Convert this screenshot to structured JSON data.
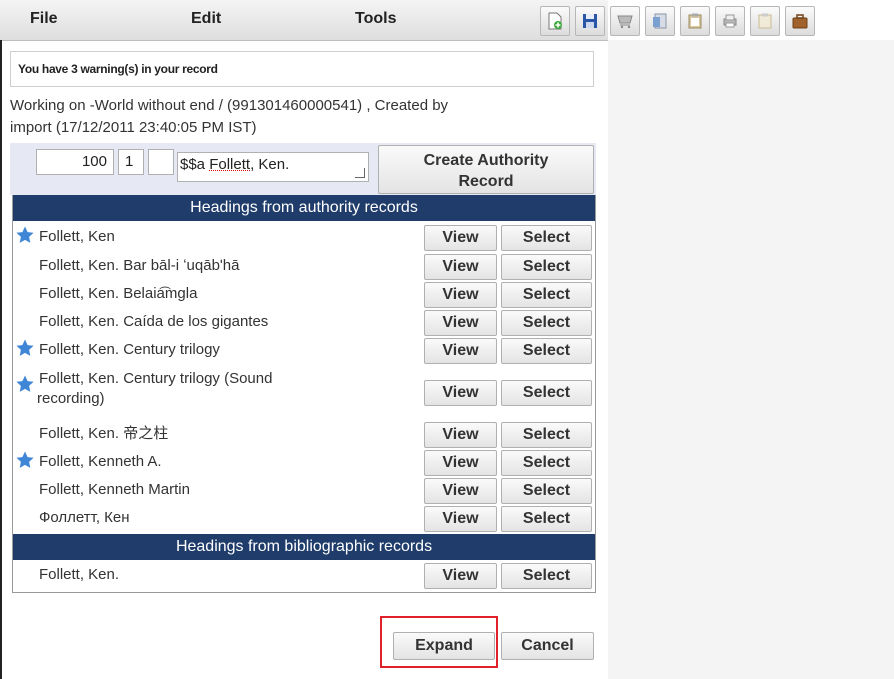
{
  "menu": {
    "file": "File",
    "edit": "Edit",
    "tools": "Tools"
  },
  "toolbar": {
    "icons": [
      "new-record-icon",
      "save-icon",
      "cart-icon",
      "document-icon",
      "clipboard-icon",
      "print-icon",
      "blank-clipboard-icon",
      "briefcase-icon"
    ]
  },
  "warning": "You have 3 warning(s) in your record",
  "working_line1": "Working on -World without end / (991301460000541) , Created by",
  "working_line2": "import (17/12/2011 23:40:05 PM IST)",
  "heading": {
    "tag": "100",
    "ind1": "1",
    "ind2": "",
    "subfield_prefix": "$$a ",
    "subfield_text": "Follett",
    "subfield_rest": ", Ken."
  },
  "create_authority": {
    "line1": "Create Authority",
    "line2": "Record"
  },
  "authority_section": "Headings from authority records",
  "bibliographic_section": "Headings from bibliographic records",
  "view_label": "View",
  "select_label": "Select",
  "authority_rows": [
    {
      "line1": "Follett, Ken",
      "line2": "",
      "preferred": true
    },
    {
      "line1": "Follett, Ken. Bar bāl-i ʻuqābʹhā",
      "line2": "",
      "preferred": false
    },
    {
      "line1": "Follett, Ken. Belaia͡mgla",
      "line2": "",
      "preferred": false
    },
    {
      "line1": "Follett, Ken. Caída de los gigantes",
      "line2": "",
      "preferred": false
    },
    {
      "line1": "Follett, Ken. Century trilogy",
      "line2": "",
      "preferred": true
    },
    {
      "line1": "Follett, Ken. Century trilogy (Sound",
      "line2": "recording)",
      "preferred": true
    },
    {
      "line1": "Follett, Ken. 帝之柱",
      "line2": "",
      "preferred": false
    },
    {
      "line1": "Follett, Kenneth A.",
      "line2": "",
      "preferred": true
    },
    {
      "line1": "Follett, Kenneth Martin",
      "line2": "",
      "preferred": false
    },
    {
      "line1": "Фоллетт, Кен",
      "line2": "",
      "preferred": false
    }
  ],
  "bibliographic_rows": [
    {
      "line1": "Follett, Ken.",
      "line2": "",
      "preferred": false
    }
  ],
  "buttons": {
    "expand": "Expand",
    "cancel": "Cancel"
  },
  "colors": {
    "section_header": "#1f3c6b",
    "highlight": "#e0202a",
    "star": "#3f86d6"
  }
}
